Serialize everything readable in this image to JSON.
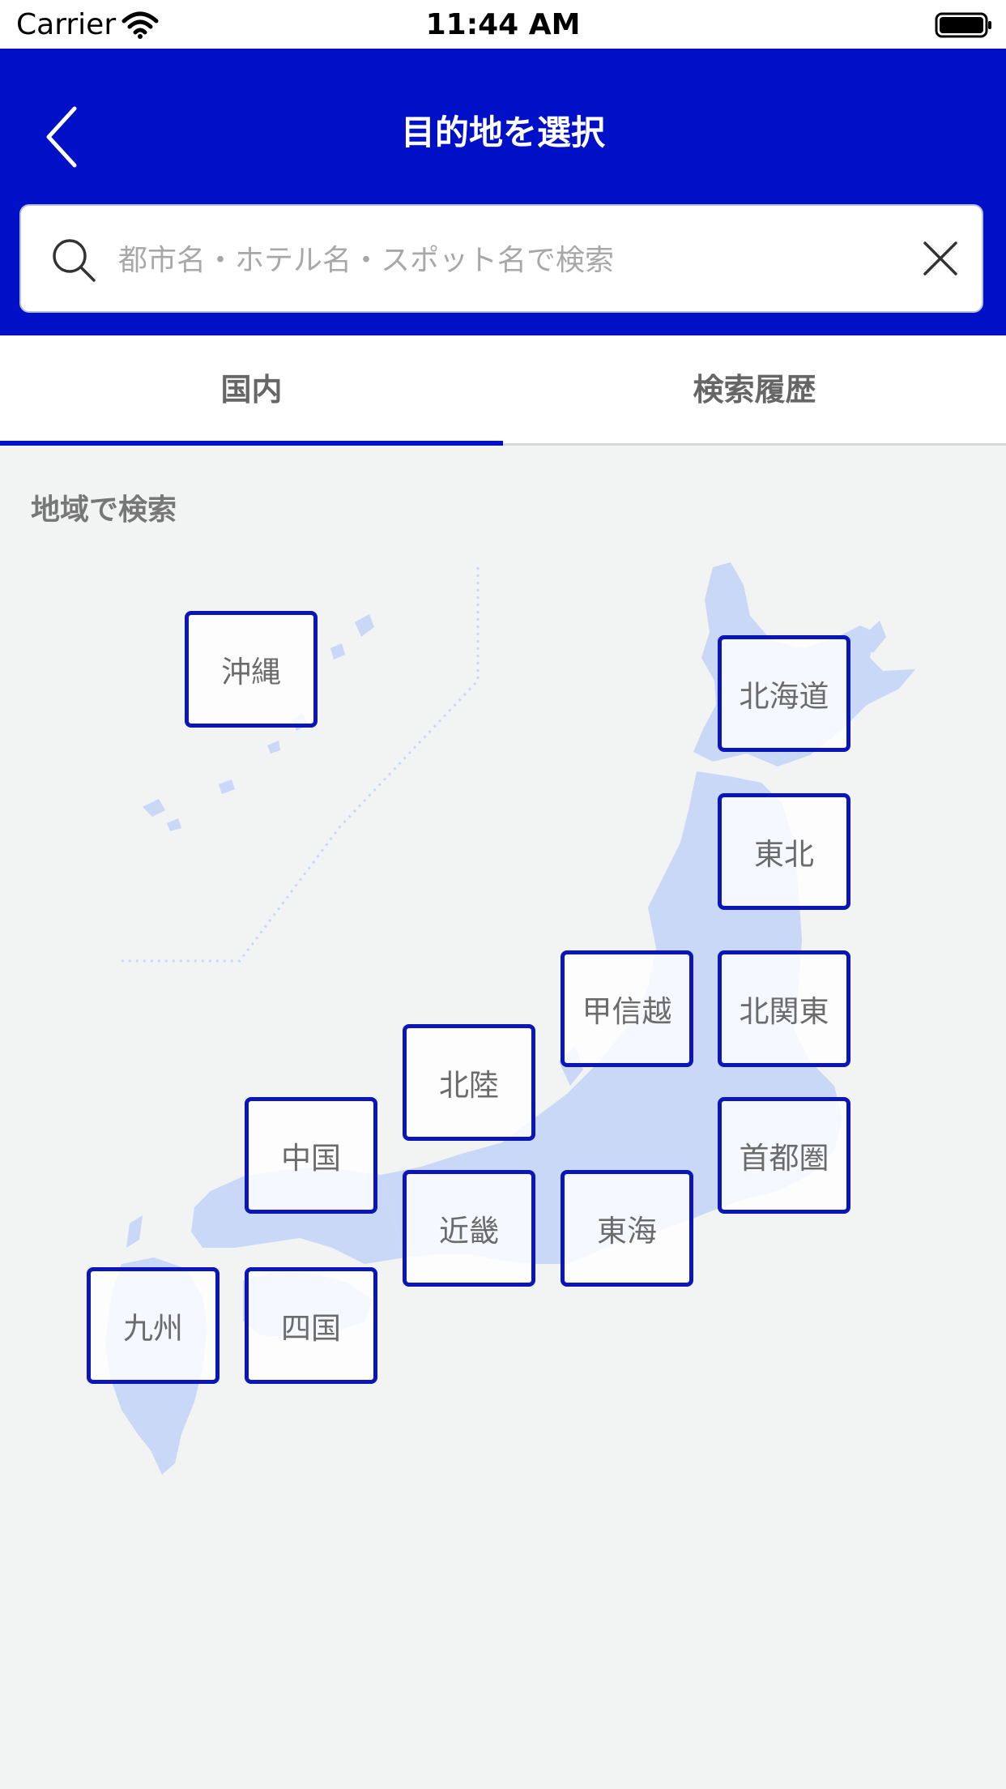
{
  "status_bar": {
    "carrier": "Carrier",
    "time": "11:44 AM"
  },
  "header": {
    "title": "目的地を選択"
  },
  "search": {
    "placeholder": "都市名・ホテル名・スポット名で検索",
    "value": ""
  },
  "tabs": [
    {
      "label": "国内",
      "selected": true
    },
    {
      "label": "検索履歴",
      "selected": false
    }
  ],
  "section_title": "地域で検索",
  "regions": {
    "okinawa": "沖縄",
    "hokkaido": "北海道",
    "tohoku": "東北",
    "koshinetsu": "甲信越",
    "kitakanto": "北関東",
    "hokuriku": "北陸",
    "chugoku": "中国",
    "shutoken": "首都圏",
    "kinki": "近畿",
    "tokai": "東海",
    "kyushu": "九州",
    "shikoku": "四国"
  },
  "colors": {
    "brand": "#0010c6",
    "map_land": "#c9d8f7",
    "background": "#f2f3f3"
  },
  "icons": [
    "wifi-icon",
    "battery-icon",
    "chevron-left-icon",
    "search-icon",
    "close-icon"
  ]
}
